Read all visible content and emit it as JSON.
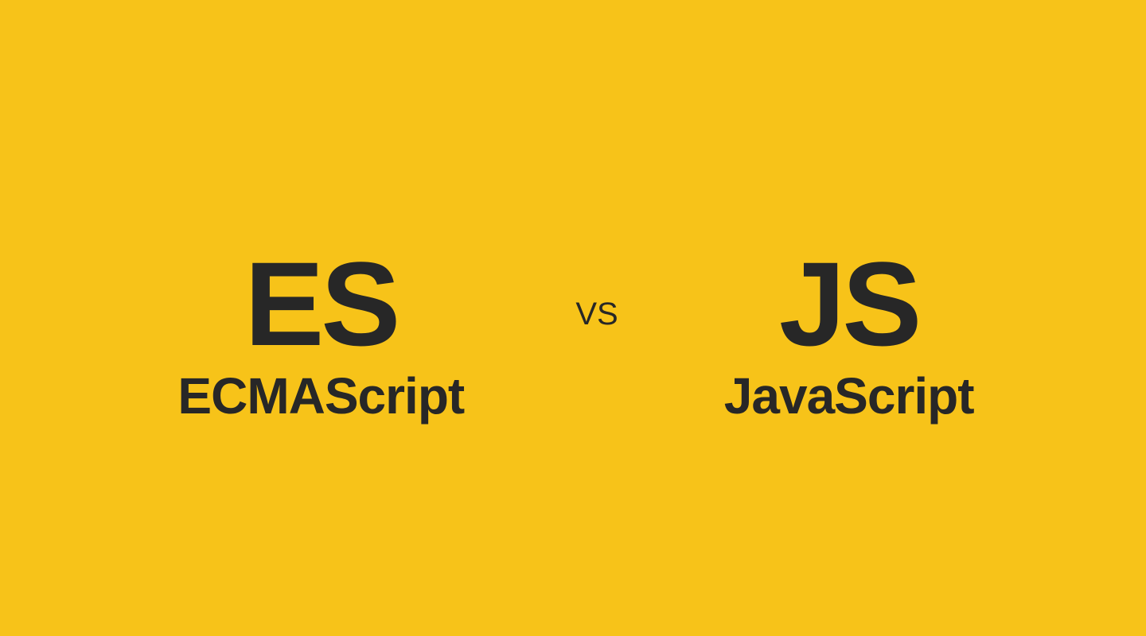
{
  "left": {
    "abbrev": "ES",
    "fullname": "ECMAScript"
  },
  "middle": {
    "vs_label": "VS"
  },
  "right": {
    "abbrev": "JS",
    "fullname": "JavaScript"
  }
}
